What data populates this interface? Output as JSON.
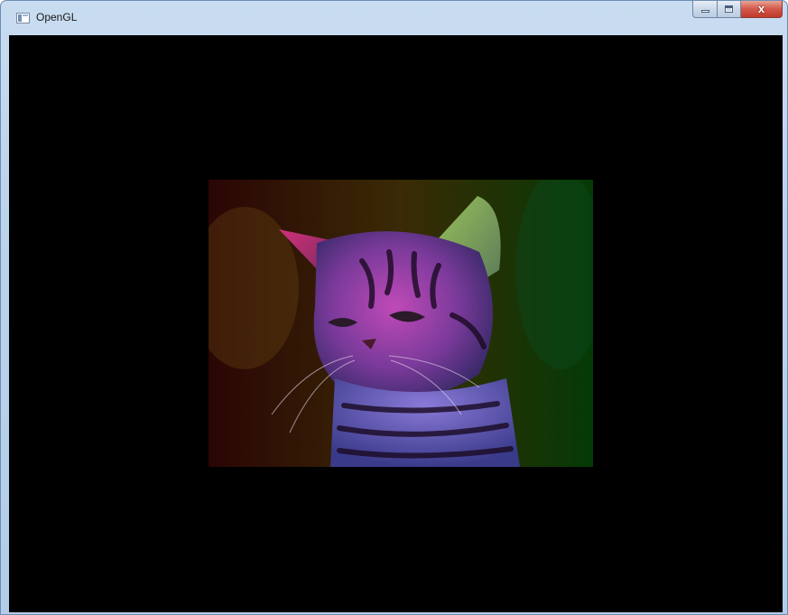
{
  "window": {
    "title": "OpenGL",
    "icon": "application-window-icon",
    "caption_buttons": {
      "minimize_icon": "minimize-icon",
      "maximize_icon": "maximize-icon",
      "close_icon": "close-icon",
      "close_glyph": "x"
    }
  },
  "viewport": {
    "background_color": "#000000",
    "rendered_image": {
      "subject": "kitten-photo",
      "vertex_colors": {
        "top_left": "#ff0000",
        "top_right": "#00ff00",
        "bottom_left": "#ffff00",
        "bottom_right": "#0000ff"
      }
    }
  }
}
